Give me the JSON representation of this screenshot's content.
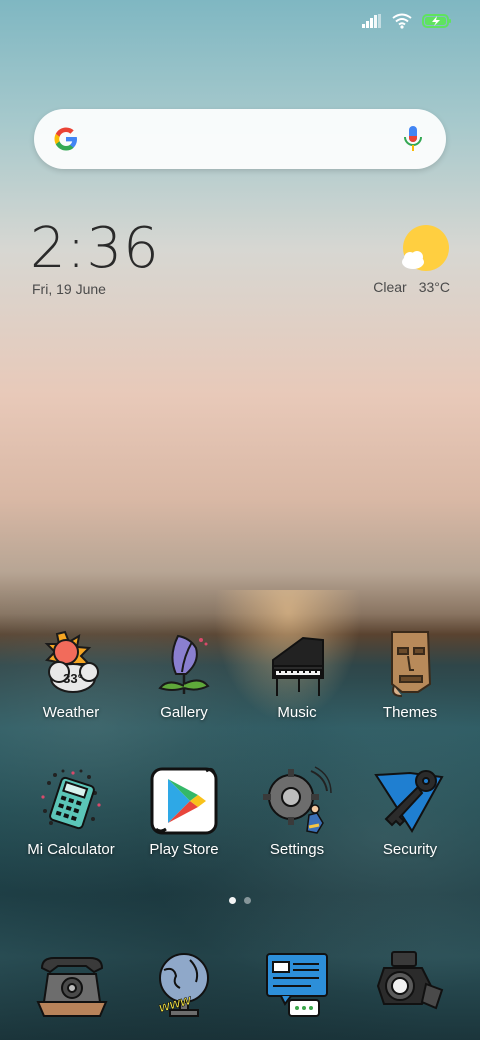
{
  "status_bar": {
    "icons": [
      "signal-icon",
      "wifi-icon",
      "battery-charging-icon"
    ]
  },
  "search": {
    "logo": "google-logo",
    "mic": "microphone-icon"
  },
  "clock_widget": {
    "time": "2:36",
    "date": "Fri, 19 June"
  },
  "weather_widget": {
    "condition": "Clear",
    "temperature": "33°C"
  },
  "apps": [
    {
      "label": "Weather",
      "icon": "weather-icon",
      "badge": "33°"
    },
    {
      "label": "Gallery",
      "icon": "gallery-icon"
    },
    {
      "label": "Music",
      "icon": "music-icon"
    },
    {
      "label": "Themes",
      "icon": "themes-icon"
    },
    {
      "label": "Mi Calculator",
      "icon": "calculator-icon"
    },
    {
      "label": "Play Store",
      "icon": "play-store-icon"
    },
    {
      "label": "Settings",
      "icon": "settings-icon"
    },
    {
      "label": "Security",
      "icon": "security-icon"
    }
  ],
  "page_indicator": {
    "total": 2,
    "active": 1
  },
  "dock": [
    {
      "icon": "phone-icon"
    },
    {
      "icon": "browser-icon",
      "text": "www"
    },
    {
      "icon": "messages-icon"
    },
    {
      "icon": "camera-icon"
    }
  ],
  "colors": {
    "accent_sun": "#ffcf40",
    "label_text": "#ffffff"
  }
}
